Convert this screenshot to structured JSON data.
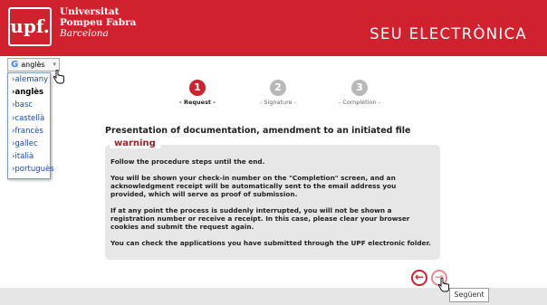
{
  "header": {
    "logo_mark": "upf.",
    "logo_line1": "Universitat",
    "logo_line2": "Pompeu Fabra",
    "logo_line3": "Barcelona",
    "title": "SEU ELECTRÒNICA",
    "color": "#d0212f"
  },
  "language": {
    "selected_label": "anglès",
    "icon": "google-g-icon",
    "options": [
      "›alemany",
      "›anglès",
      "›basc",
      "›castellà",
      "›francès",
      "›gallec",
      "›italià",
      "›portuguès"
    ]
  },
  "steps": [
    {
      "number": "1",
      "label": "- Request -",
      "active": true
    },
    {
      "number": "2",
      "label": "- Signature -",
      "active": false
    },
    {
      "number": "3",
      "label": "- Completion -",
      "active": false
    }
  ],
  "main": {
    "title": "Presentation of documentation, amendment to an initiated file"
  },
  "warning": {
    "label": "warning",
    "paragraphs": [
      "Follow the procedure steps until the end.",
      "You will be shown your check-in number on the \"Completion\" screen, and an acknowledgment receipt will be automatically sent to the email address you provided, which will serve as proof of submission.",
      "If at any point the process is suddenly interrupted, you will not be shown a registration number or receive a receipt. In this case, please clear your browser cookies and submit the request again.",
      "You can check the applications you have submitted through the UPF electronic folder."
    ]
  },
  "nav": {
    "prev_icon": "arrow-left-circle-icon",
    "next_icon": "arrow-right-circle-icon",
    "next_tooltip": "Següent"
  }
}
